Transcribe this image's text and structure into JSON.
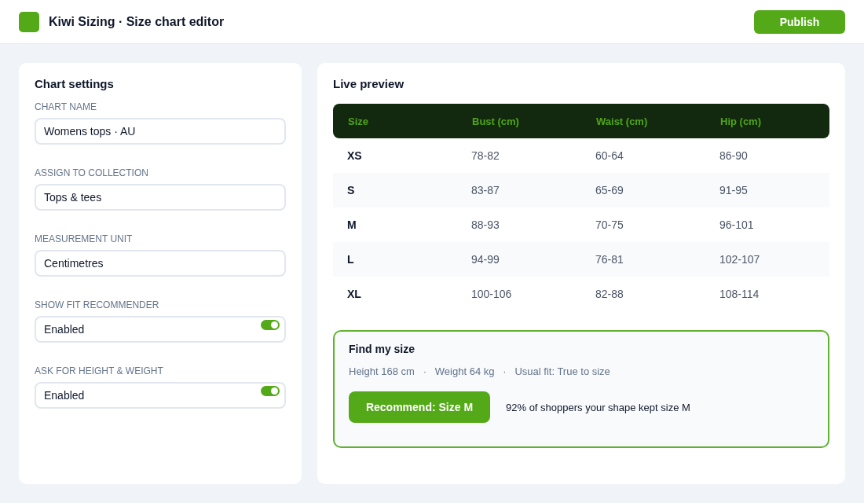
{
  "header": {
    "title": "Kiwi Sizing · Size chart editor",
    "publish_button": "Publish"
  },
  "settings": {
    "title": "Chart settings",
    "fields": [
      {
        "kind": "text",
        "label": "CHART NAME",
        "value": "Womens tops · AU"
      },
      {
        "kind": "text",
        "label": "ASSIGN TO COLLECTION",
        "value": "Tops & tees"
      },
      {
        "kind": "text",
        "label": "MEASUREMENT UNIT",
        "value": "Centimetres"
      },
      {
        "kind": "toggle",
        "label": "SHOW FIT RECOMMENDER",
        "value": "Enabled",
        "on": true
      },
      {
        "kind": "toggle",
        "label": "ASK FOR HEIGHT & WEIGHT",
        "value": "Enabled",
        "on": true
      }
    ]
  },
  "preview": {
    "title": "Live preview",
    "table": {
      "columns": [
        "Size",
        "Bust (cm)",
        "Waist (cm)",
        "Hip (cm)"
      ],
      "rows": [
        [
          "XS",
          "78-82",
          "60-64",
          "86-90"
        ],
        [
          "S",
          "83-87",
          "65-69",
          "91-95"
        ],
        [
          "M",
          "88-93",
          "70-75",
          "96-101"
        ],
        [
          "L",
          "94-99",
          "76-81",
          "102-107"
        ],
        [
          "XL",
          "100-106",
          "82-88",
          "108-114"
        ]
      ]
    },
    "recommender": {
      "title": "Find my size",
      "details": "Height 168 cm   ·   Weight 64 kg   ·   Usual fit: True to size",
      "button": "Recommend: Size M",
      "note": "92% of shoppers your shape kept size M"
    }
  }
}
